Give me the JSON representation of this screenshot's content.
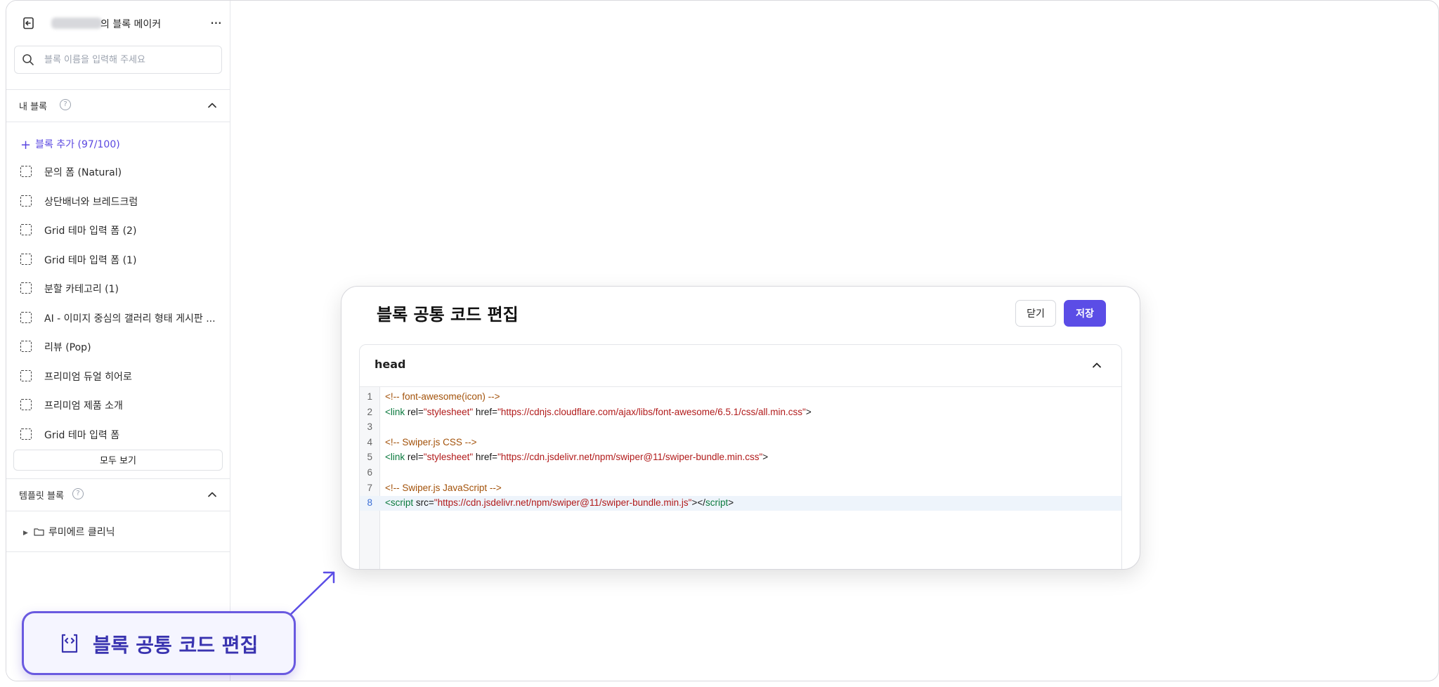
{
  "sidebar": {
    "header": {
      "title": "의 블록 메이커",
      "more": "···"
    },
    "search": {
      "placeholder": "블록 이름을 입력해 주세요",
      "value": ""
    },
    "my_blocks": {
      "label": "내 블록",
      "help": "?",
      "add_label": "블록 추가 (97/100)",
      "items": [
        "문의 폼 (Natural)",
        "상단배너와 브레드크럼",
        "Grid 테마 입력 폼 (2)",
        "Grid 테마 입력 폼 (1)",
        "분할 카테고리 (1)",
        "AI - 이미지 중심의 갤러리 형태 게시판 ...",
        "리뷰 (Pop)",
        "프리미엄 듀얼 히어로",
        "프리미엄 제품 소개",
        "Grid 테마 입력 폼"
      ],
      "view_all": "모두 보기"
    },
    "template_blocks": {
      "label": "템플릿 블록",
      "help": "?",
      "folders": [
        "루미에르 클리닉"
      ]
    }
  },
  "modal": {
    "title": "블록 공통 코드 편집",
    "close_label": "닫기",
    "save_label": "저장",
    "panel": {
      "label": "head"
    },
    "code_lines": [
      {
        "num": "1",
        "tokens": [
          {
            "t": "com",
            "v": "<!-- font-awesome(icon) -->"
          }
        ]
      },
      {
        "num": "2",
        "tokens": [
          {
            "t": "tag",
            "v": "<link"
          },
          {
            "t": "attr",
            "v": " rel="
          },
          {
            "t": "str",
            "v": "\"stylesheet\""
          },
          {
            "t": "attr",
            "v": " href="
          },
          {
            "t": "str",
            "v": "\"https://cdnjs.cloudflare.com/ajax/libs/font-awesome/6.5.1/css/all.min.css\""
          },
          {
            "t": "attr",
            "v": ">"
          }
        ]
      },
      {
        "num": "3",
        "tokens": []
      },
      {
        "num": "4",
        "tokens": [
          {
            "t": "com",
            "v": "<!-- Swiper.js CSS -->"
          }
        ]
      },
      {
        "num": "5",
        "tokens": [
          {
            "t": "tag",
            "v": "<link"
          },
          {
            "t": "attr",
            "v": " rel="
          },
          {
            "t": "str",
            "v": "\"stylesheet\""
          },
          {
            "t": "attr",
            "v": " href="
          },
          {
            "t": "str",
            "v": "\"https://cdn.jsdelivr.net/npm/swiper@11/swiper-bundle.min.css\""
          },
          {
            "t": "attr",
            "v": ">"
          }
        ]
      },
      {
        "num": "6",
        "tokens": []
      },
      {
        "num": "7",
        "tokens": [
          {
            "t": "com",
            "v": "<!-- Swiper.js JavaScript -->"
          }
        ]
      },
      {
        "num": "8",
        "tokens": [
          {
            "t": "tag",
            "v": "<script"
          },
          {
            "t": "attr",
            "v": " src="
          },
          {
            "t": "str",
            "v": "\"https://cdn.jsdelivr.net/npm/swiper@11/swiper-bundle.min.js\""
          },
          {
            "t": "attr",
            "v": "></"
          },
          {
            "t": "tag",
            "v": "script"
          },
          {
            "t": "attr",
            "v": ">"
          }
        ]
      }
    ],
    "active_line": "8"
  },
  "callout": {
    "label": "블록 공통 코드 편집"
  },
  "colors": {
    "accent": "#5b4de6",
    "callout_border": "#6a5ae0"
  }
}
